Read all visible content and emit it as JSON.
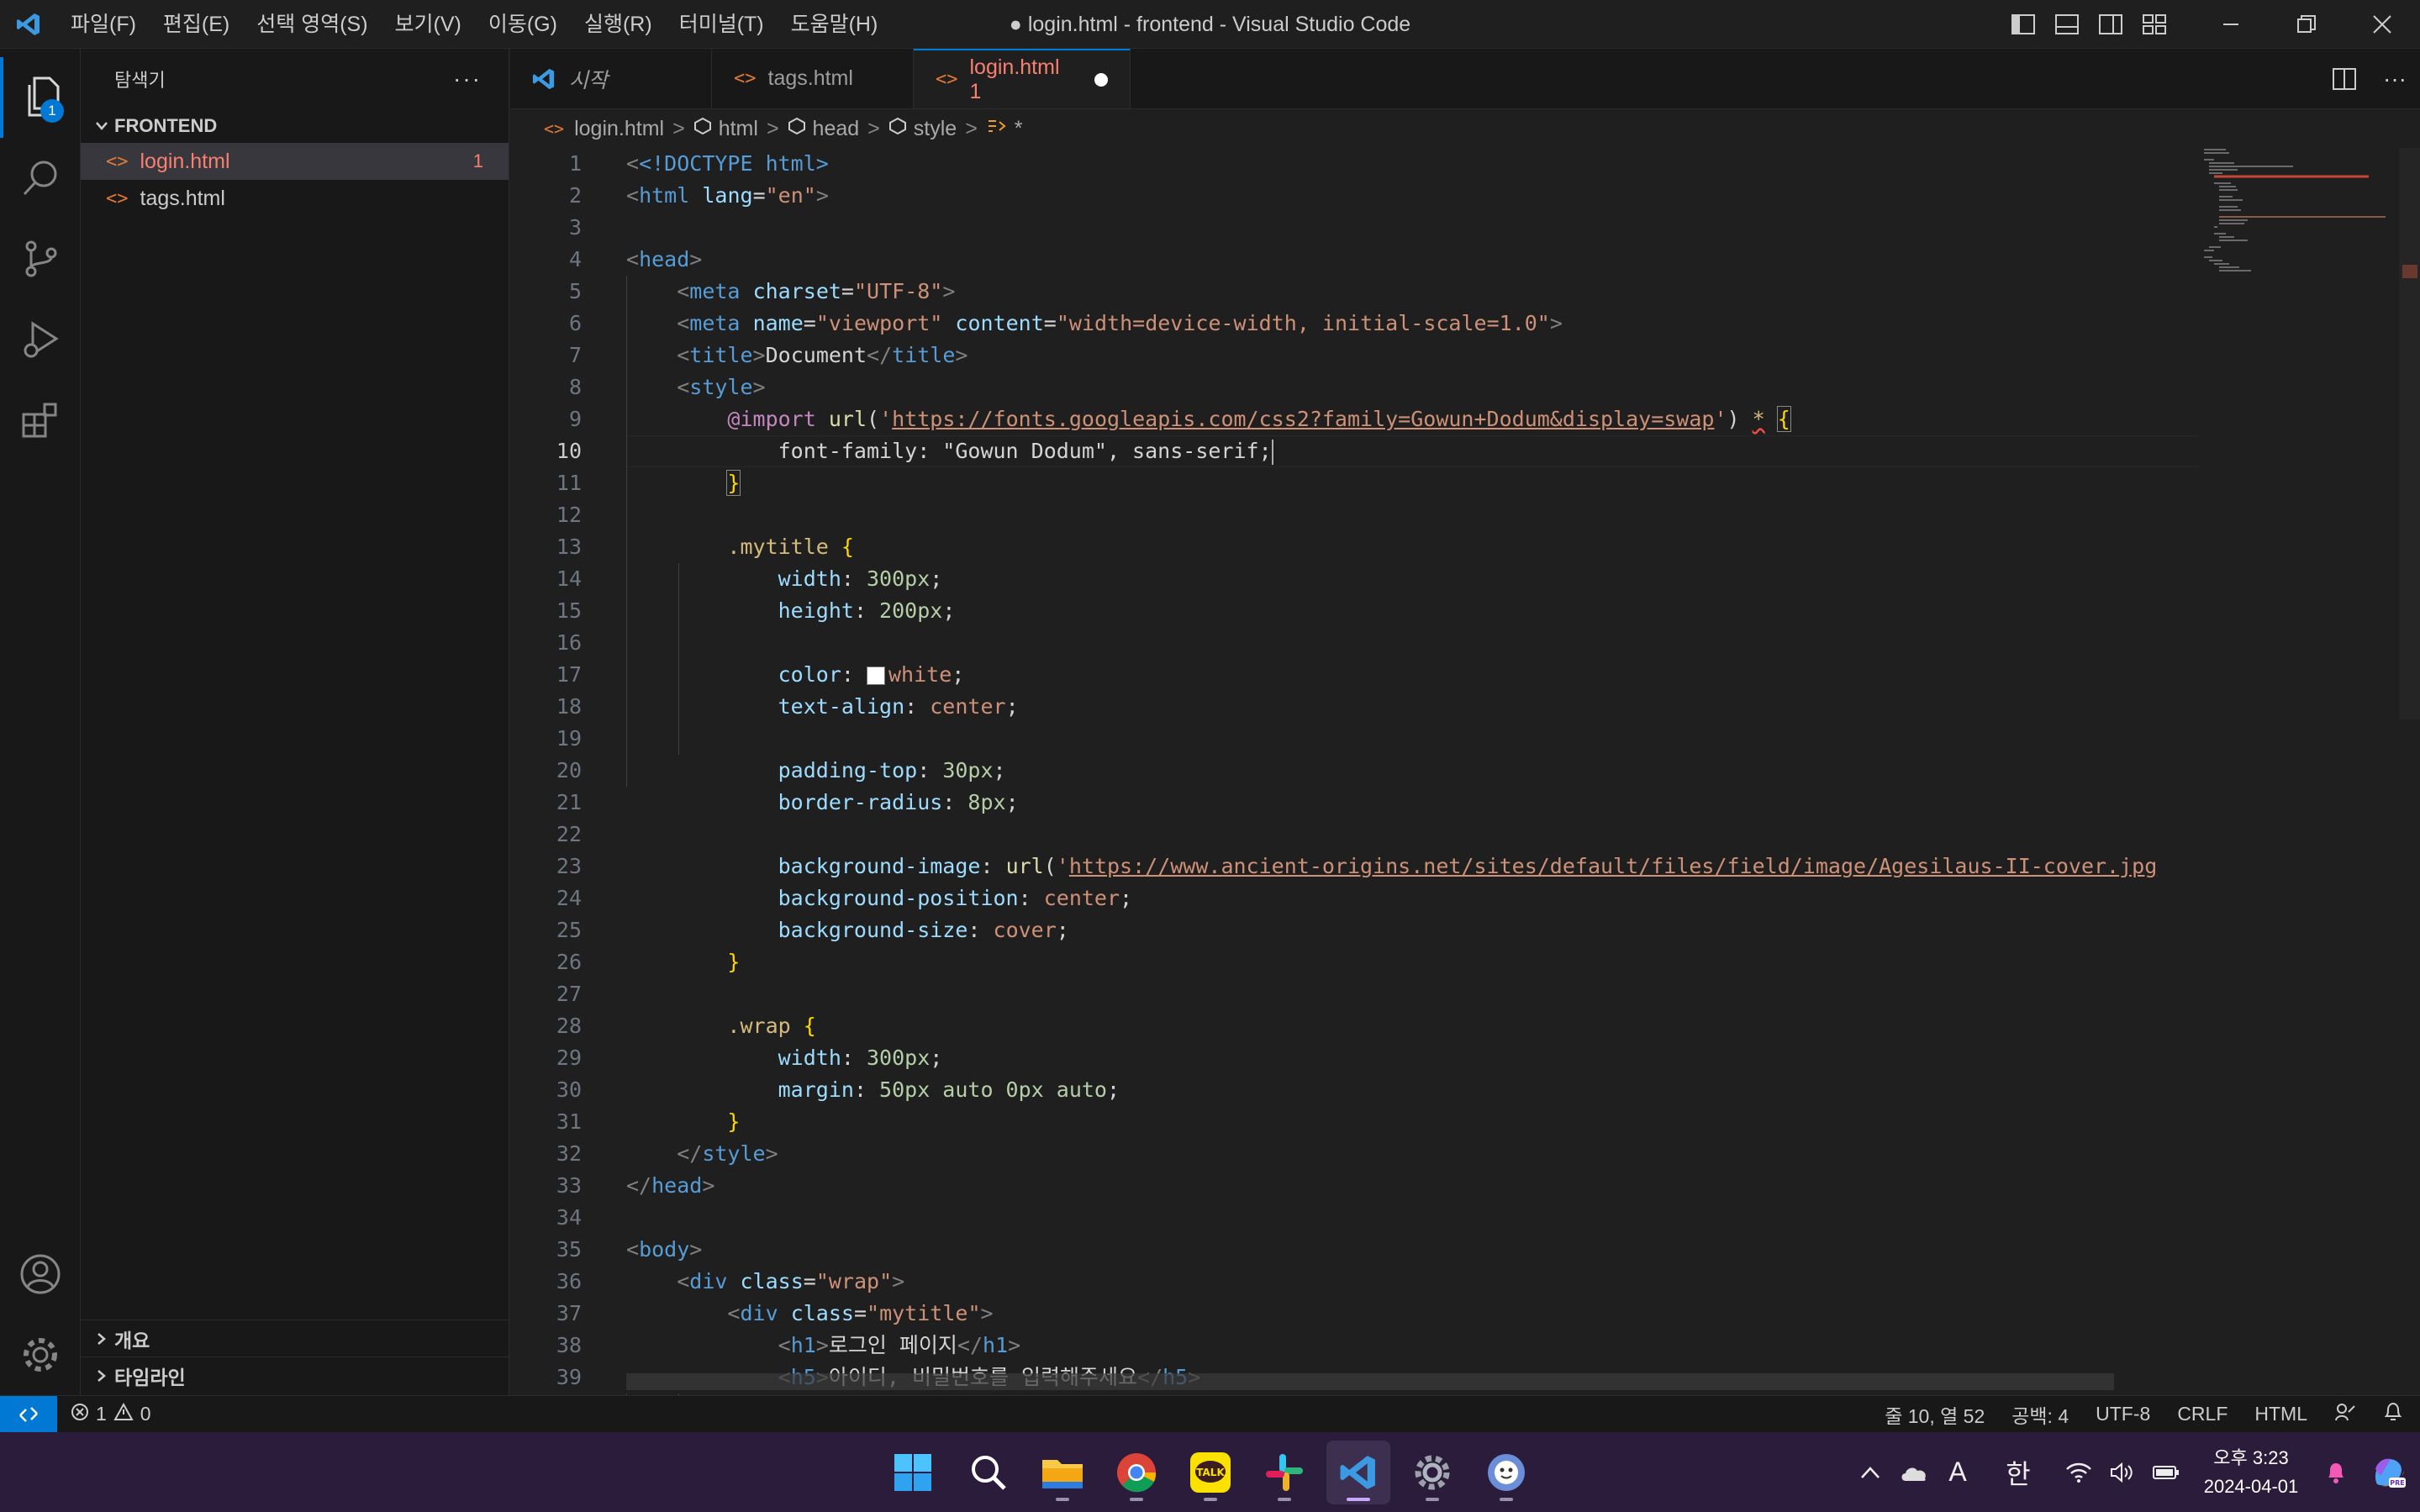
{
  "window": {
    "title": "● login.html - frontend - Visual Studio Code",
    "menu": [
      "파일(F)",
      "편집(E)",
      "선택 영역(S)",
      "보기(V)",
      "이동(G)",
      "실행(R)",
      "터미널(T)",
      "도움말(H)"
    ]
  },
  "activity_bar": {
    "explorer_badge": "1"
  },
  "sidebar": {
    "title": "탐색기",
    "folder": "FRONTEND",
    "files": [
      {
        "name": "login.html",
        "badge": "1",
        "selected": true
      },
      {
        "name": "tags.html",
        "badge": "",
        "selected": false
      }
    ],
    "outline_label": "개요",
    "timeline_label": "타임라인"
  },
  "tabs": [
    {
      "label": "시작",
      "type": "welcome"
    },
    {
      "label": "tags.html",
      "type": "html"
    },
    {
      "label": "login.html 1",
      "type": "html",
      "active": true,
      "dirty": true
    }
  ],
  "breadcrumb": [
    "login.html",
    "html",
    "head",
    "style",
    "*"
  ],
  "editor": {
    "current_line": 10,
    "lines": [
      {
        "n": "1"
      },
      {
        "n": "2"
      },
      {
        "n": "3"
      },
      {
        "n": "4"
      },
      {
        "n": "5"
      },
      {
        "n": "6"
      },
      {
        "n": "7"
      },
      {
        "n": "8"
      },
      {
        "n": "9"
      },
      {
        "n": "10"
      },
      {
        "n": "11"
      },
      {
        "n": "12"
      },
      {
        "n": "13"
      },
      {
        "n": "14"
      },
      {
        "n": "15"
      },
      {
        "n": "16"
      },
      {
        "n": "17"
      },
      {
        "n": "18"
      },
      {
        "n": "19"
      },
      {
        "n": "20"
      },
      {
        "n": "21"
      },
      {
        "n": "22"
      },
      {
        "n": "23"
      },
      {
        "n": "24"
      },
      {
        "n": "25"
      },
      {
        "n": "26"
      },
      {
        "n": "27"
      },
      {
        "n": "28"
      },
      {
        "n": "29"
      },
      {
        "n": "30"
      },
      {
        "n": "31"
      },
      {
        "n": "32"
      },
      {
        "n": "33"
      },
      {
        "n": "34"
      },
      {
        "n": "35"
      },
      {
        "n": "36"
      },
      {
        "n": "37"
      },
      {
        "n": "38"
      },
      {
        "n": "39"
      }
    ],
    "code": {
      "l1": "<!DOCTYPE html>",
      "l2_lang": "\"en\"",
      "l6_name": "\"viewport\"",
      "l6_content": "\"width=device-width, initial-scale=1.0\"",
      "l7_title": "Document",
      "l9_url": "https://fonts.googleapis.com/css2?family=Gowun+Dodum&display=swap",
      "l10": "font-family: \"Gowun Dodum\", sans-serif;",
      "l13": ".mytitle",
      "l14": "300px",
      "l15": "200px",
      "l17": "white",
      "l18": "center",
      "l20": "30px",
      "l21": "8px",
      "l23_url": "https://www.ancient-origins.net/sites/default/files/field/image/Agesilaus-II-cover.jpg",
      "l24": "center",
      "l25": "cover",
      "l28": ".wrap",
      "l29": "300px",
      "l30": "50px auto 0px auto",
      "l36_class": "\"wrap\"",
      "l37_class": "\"mytitle\"",
      "l38_text": "로그인 페이지",
      "l39_text": "아이디, 비밀번호를 입력해주세요"
    }
  },
  "status_bar": {
    "errors": "1",
    "warnings": "0",
    "cursor": "줄 10, 열 52",
    "spaces": "공백: 4",
    "encoding": "UTF-8",
    "eol": "CRLF",
    "language": "HTML"
  },
  "taskbar": {
    "time": "오후 3:23",
    "date": "2024-04-01",
    "ime": "한",
    "font_glyph": "A"
  },
  "colors": {
    "accent": "#0078d4",
    "editor_bg": "#1f1f1f",
    "error_file": "#f88070",
    "html_icon": "#e37933"
  }
}
